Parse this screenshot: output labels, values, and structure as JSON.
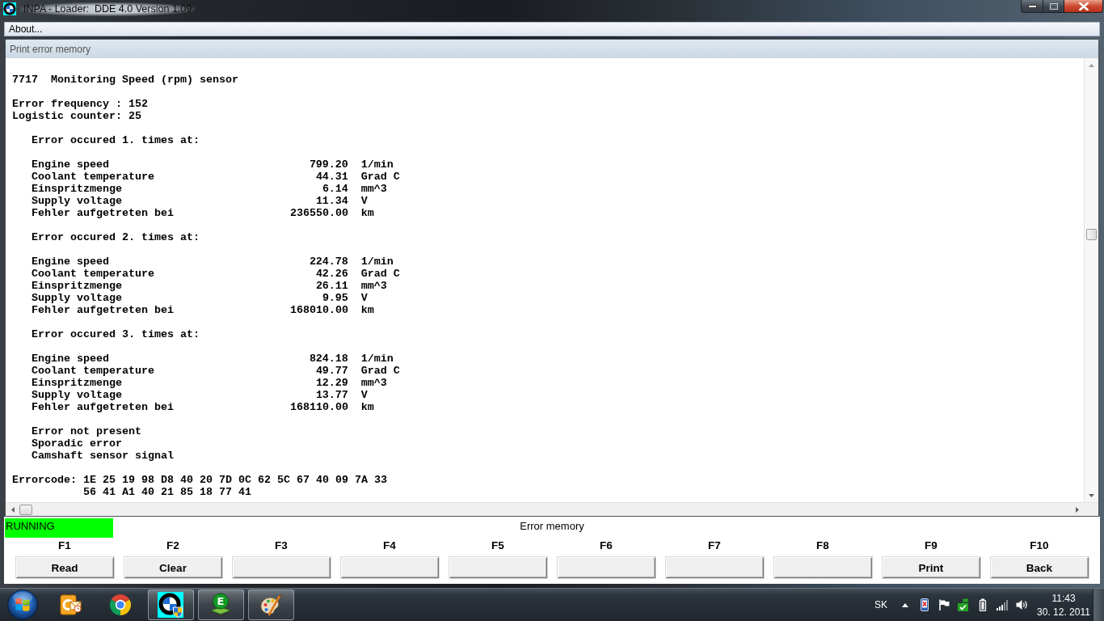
{
  "window": {
    "title": "INPA - Loader:  DDE 4.0 Version 1.09"
  },
  "menu": [
    {
      "label": "About..."
    }
  ],
  "panel": {
    "title": "Print error memory"
  },
  "report": {
    "fault": {
      "code": "7717",
      "name": "Monitoring Speed (rpm) sensor"
    },
    "counters": [
      "Error frequency : 152",
      "Logistic counter: 25"
    ],
    "occurrences": [
      {
        "heading": "Error occured 1. times at:",
        "readings": [
          {
            "label": "Engine speed",
            "value": "799.20",
            "unit": "1/min"
          },
          {
            "label": "Coolant temperature",
            "value": "44.31",
            "unit": "Grad C"
          },
          {
            "label": "Einspritzmenge",
            "value": "6.14",
            "unit": "mm^3"
          },
          {
            "label": "Supply voltage",
            "value": "11.34",
            "unit": "V"
          },
          {
            "label": "Fehler aufgetreten bei",
            "value": "236550.00",
            "unit": "km"
          }
        ]
      },
      {
        "heading": "Error occured 2. times at:",
        "readings": [
          {
            "label": "Engine speed",
            "value": "224.78",
            "unit": "1/min"
          },
          {
            "label": "Coolant temperature",
            "value": "42.26",
            "unit": "Grad C"
          },
          {
            "label": "Einspritzmenge",
            "value": "26.11",
            "unit": "mm^3"
          },
          {
            "label": "Supply voltage",
            "value": "9.95",
            "unit": "V"
          },
          {
            "label": "Fehler aufgetreten bei",
            "value": "168010.00",
            "unit": "km"
          }
        ]
      },
      {
        "heading": "Error occured 3. times at:",
        "readings": [
          {
            "label": "Engine speed",
            "value": "824.18",
            "unit": "1/min"
          },
          {
            "label": "Coolant temperature",
            "value": "49.77",
            "unit": "Grad C"
          },
          {
            "label": "Einspritzmenge",
            "value": "12.29",
            "unit": "mm^3"
          },
          {
            "label": "Supply voltage",
            "value": "13.77",
            "unit": "V"
          },
          {
            "label": "Fehler aufgetreten bei",
            "value": "168110.00",
            "unit": "km"
          }
        ]
      }
    ],
    "conditions": [
      "Error not present",
      "Sporadic error",
      "Camshaft sensor signal"
    ],
    "errorcode": {
      "label": "Errorcode:",
      "lines": [
        "1E 25 19 98 D8 40 20 7D 0C 62 5C 67 40 09 7A 33",
        "56 41 A1 40 21 85 18 77 41"
      ]
    }
  },
  "status": {
    "state": "RUNNING",
    "screen": "Error memory"
  },
  "function_keys": [
    {
      "key": "F1",
      "label": "Read"
    },
    {
      "key": "F2",
      "label": "Clear"
    },
    {
      "key": "F3"
    },
    {
      "key": "F4"
    },
    {
      "key": "F5"
    },
    {
      "key": "F6"
    },
    {
      "key": "F7"
    },
    {
      "key": "F8"
    },
    {
      "key": "F9",
      "label": "Print"
    },
    {
      "key": "F10",
      "label": "Back"
    }
  ],
  "taskbar": {
    "apps": [
      {
        "kind": "mail",
        "running": false
      },
      {
        "kind": "browser",
        "running": false
      },
      {
        "kind": "roundel",
        "running": true
      },
      {
        "kind": "letter-book",
        "letter": "E",
        "running": true
      },
      {
        "kind": "palette",
        "running": true
      }
    ],
    "language": "SK",
    "time": "11:43",
    "date": "30. 12. 2011"
  }
}
